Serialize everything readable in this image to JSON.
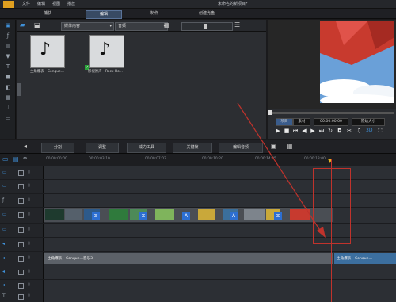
{
  "menu": [
    "文件",
    "编辑",
    "视图",
    "播放"
  ],
  "app_title": "未命名的新项目*",
  "tabs": [
    {
      "label": "捕获",
      "active": false
    },
    {
      "label": "编辑",
      "active": true
    },
    {
      "label": "制作",
      "active": false
    },
    {
      "label": "创建光盘",
      "active": false
    }
  ],
  "library": {
    "filter_value": "媒体内容",
    "type_value": "音频",
    "items": [
      {
        "caption": "主角爆表 - Conque...",
        "icon": "music-note-icon",
        "selected": true
      },
      {
        "caption": "影视原声 - Rock Ho...",
        "icon": "music-note-icon",
        "selected": false
      }
    ]
  },
  "player": {
    "mode_project": "项目",
    "mode_clip": "素材",
    "timecode": "00:00:00.00",
    "clip_timecode": "00:00:00.00",
    "size_label": "原始大小"
  },
  "edit_toolbar": [
    "分割",
    "调整",
    "威力工具",
    "关键帧",
    "编辑音频"
  ],
  "ruler_ticks": [
    "00:00:00:00",
    "00:00:03:10",
    "00:00:07:02",
    "00:00:10:20",
    "00:00:14:05",
    "00:00:18:00"
  ],
  "audio_track_1_label": "主角爆表 - Conque...音乐3",
  "audio_track_2_label": "主角爆表 - Conque...",
  "colors": {
    "accent": "#3b6fb0",
    "playhead": "#c0332c"
  }
}
